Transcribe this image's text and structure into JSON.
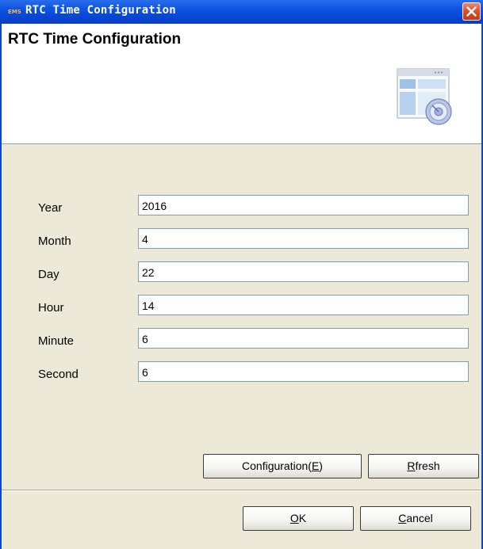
{
  "window": {
    "title": "RTC Time Configuration",
    "title_icon_text": "EMS"
  },
  "header": {
    "title": "RTC Time Configuration"
  },
  "form": {
    "fields": [
      {
        "label": "Year",
        "value": "2016"
      },
      {
        "label": "Month",
        "value": "4"
      },
      {
        "label": "Day",
        "value": "22"
      },
      {
        "label": "Hour",
        "value": "14"
      },
      {
        "label": "Minute",
        "value": "6"
      },
      {
        "label": "Second",
        "value": "6"
      }
    ]
  },
  "buttons": {
    "configuration": {
      "before": "Configuration(",
      "mnemonic": "E",
      "after": ")"
    },
    "refresh": {
      "before": "",
      "mnemonic": "R",
      "after": "fresh"
    },
    "ok": {
      "before": "",
      "mnemonic": "O",
      "after": "K"
    },
    "cancel": {
      "before": "",
      "mnemonic": "C",
      "after": "ancel"
    }
  },
  "colors": {
    "titlebar": "#0a47d0",
    "close_button": "#d6502b",
    "dialog_background": "#ece9d8"
  }
}
